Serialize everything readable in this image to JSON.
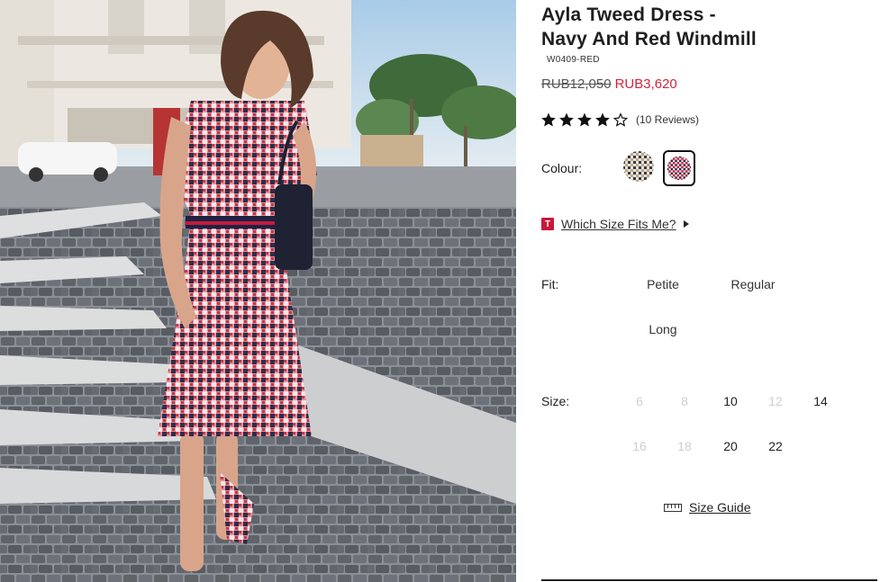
{
  "product": {
    "title": "Ayla Tweed Dress -\nNavy And Red Windmill",
    "sku": "W0409-RED",
    "price_was": "RUB12,050",
    "price_now": "RUB3,620",
    "rating": 4,
    "rating_max": 5,
    "reviews_label": "(10 Reviews)"
  },
  "colour": {
    "label": "Colour:",
    "swatches": [
      {
        "name": "neutral-tweed",
        "selected": false
      },
      {
        "name": "navy-and-red-windmill",
        "selected": true
      }
    ]
  },
  "size_help": {
    "badge": "T",
    "link": "Which Size Fits Me?"
  },
  "fit": {
    "label": "Fit:",
    "options": [
      "Petite",
      "Regular",
      "Long"
    ]
  },
  "size": {
    "label": "Size:",
    "options": [
      {
        "value": "6",
        "available": false
      },
      {
        "value": "8",
        "available": false
      },
      {
        "value": "10",
        "available": true
      },
      {
        "value": "12",
        "available": false
      },
      {
        "value": "14",
        "available": true
      },
      {
        "value": "16",
        "available": false
      },
      {
        "value": "18",
        "available": false
      },
      {
        "value": "20",
        "available": true
      },
      {
        "value": "22",
        "available": true
      }
    ]
  },
  "size_guide": {
    "label": "Size Guide",
    "icon": "ruler-icon"
  },
  "colors": {
    "sale": "#d0243c",
    "badge": "#c8193c",
    "unavailable": "#cfcfcf"
  }
}
